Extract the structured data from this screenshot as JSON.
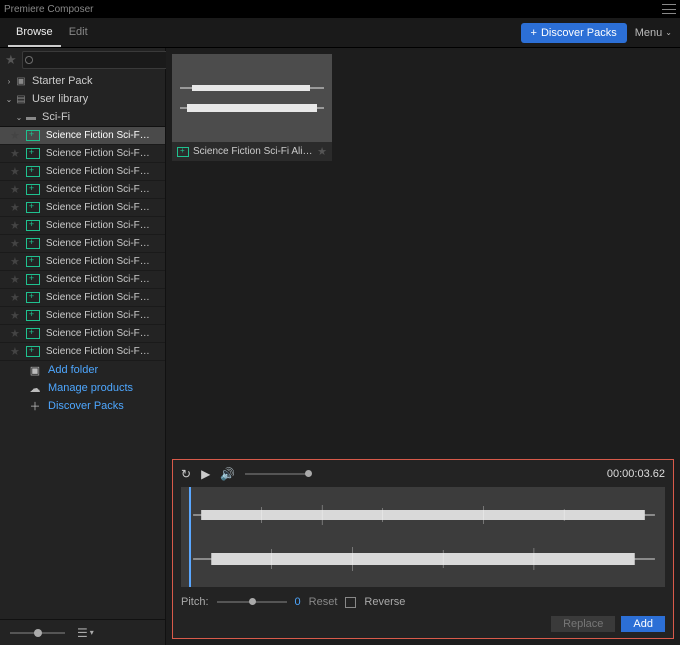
{
  "titlebar": {
    "title": "Premiere Composer"
  },
  "tabs": {
    "browse": "Browse",
    "edit": "Edit"
  },
  "header": {
    "discover": "Discover Packs",
    "menu": "Menu"
  },
  "search": {
    "placeholder": ""
  },
  "tree": {
    "starter": "Starter Pack",
    "userlib": "User library",
    "scifi": "Sci-Fi"
  },
  "assets": [
    "Science Fiction Sci-F…",
    "Science Fiction Sci-F…",
    "Science Fiction Sci-F…",
    "Science Fiction Sci-F…",
    "Science Fiction Sci-F…",
    "Science Fiction Sci-F…",
    "Science Fiction Sci-F…",
    "Science Fiction Sci-F…",
    "Science Fiction Sci-F…",
    "Science Fiction Sci-F…",
    "Science Fiction Sci-F…",
    "Science Fiction Sci-F…",
    "Science Fiction Sci-F…"
  ],
  "sidebar_actions": {
    "add_folder": "Add folder",
    "manage": "Manage products",
    "discover": "Discover Packs"
  },
  "thumb": {
    "caption": "Science Fiction Sci-Fi Alien …"
  },
  "preview": {
    "timecode": "00:00:03.62",
    "pitch_label": "Pitch:",
    "pitch_value": "0",
    "reset": "Reset",
    "reverse": "Reverse",
    "replace": "Replace",
    "add": "Add"
  }
}
